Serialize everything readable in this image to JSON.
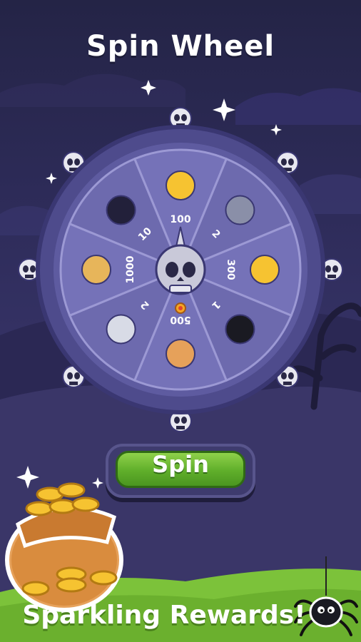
{
  "screen": {
    "title": "Spin Wheel",
    "spin_button_label": "Spin",
    "bottom_banner": "Sparkling Rewards!"
  },
  "wheel": {
    "segments": [
      {
        "label": "100",
        "prize_icon": "skull-coin-icon"
      },
      {
        "label": "2",
        "prize_icon": "axe-icon"
      },
      {
        "label": "300",
        "prize_icon": "coin-stack-icon"
      },
      {
        "label": "1",
        "prize_icon": "bomb-icon"
      },
      {
        "label": "500",
        "prize_icon": "gold-sack-icon"
      },
      {
        "label": "2",
        "prize_icon": "crossed-daggers-icon"
      },
      {
        "label": "1000",
        "prize_icon": "treasure-scroll-icon"
      },
      {
        "label": "10",
        "prize_icon": "gem-bomb-icon"
      }
    ],
    "center_icon": "skull-pointer-icon"
  },
  "colors": {
    "background": "#2d2b58",
    "wheel_rim": "#4e4b8c",
    "wheel_segment": "#7471b6",
    "spin_button": "#5fae2a",
    "grass": "#7cc23a"
  }
}
